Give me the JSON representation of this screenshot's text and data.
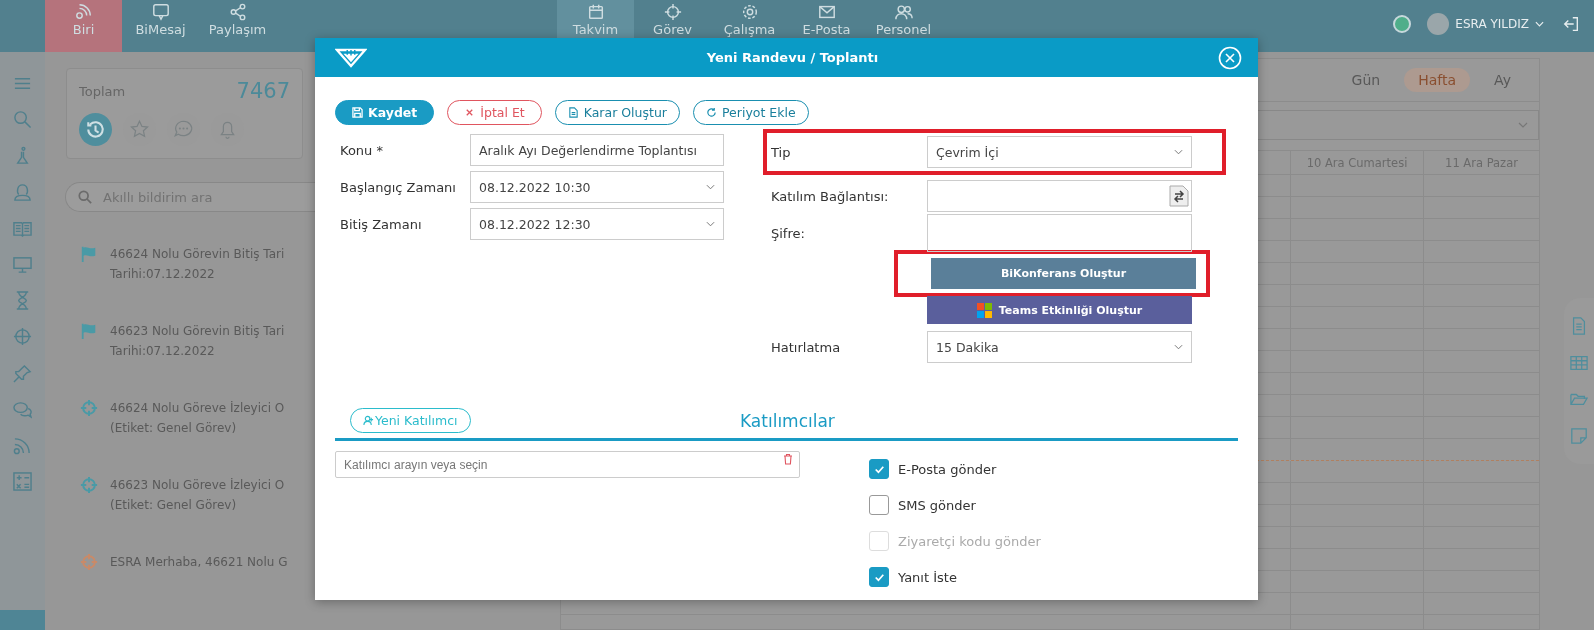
{
  "top_nav": {
    "left_items": [
      {
        "label": "Biri",
        "selected": true
      },
      {
        "label": "BiMesaj",
        "selected": false
      },
      {
        "label": "Paylaşım",
        "selected": false
      }
    ],
    "center_items": [
      {
        "label": "Takvim",
        "selected": true
      },
      {
        "label": "Görev",
        "selected": false
      },
      {
        "label": "Çalışma",
        "selected": false
      },
      {
        "label": "E-Posta",
        "selected": false
      },
      {
        "label": "Personel",
        "selected": false
      }
    ],
    "user": {
      "name": "ESRA YILDIZ"
    }
  },
  "summary": {
    "label": "Toplam",
    "count": "7467"
  },
  "notification_search": {
    "placeholder": "Akıllı bildirim ara"
  },
  "notifications": [
    {
      "kind": "flag",
      "color": "#4a9aa6",
      "lines": [
        "46624 Nolu Görevin Bitiş Tari",
        "Tarihi:07.12.2022"
      ]
    },
    {
      "kind": "flag",
      "color": "#4a9aa6",
      "lines": [
        "46623 Nolu Görevin Bitiş Tari",
        "Tarihi:07.12.2022"
      ]
    },
    {
      "kind": "target",
      "color": "#4a9aa6",
      "lines": [
        "46624 Nolu Göreve İzleyici O",
        "(Etiket: Genel Görev)"
      ]
    },
    {
      "kind": "target",
      "color": "#4a9aa6",
      "lines": [
        "46623 Nolu Göreve İzleyici O",
        "(Etiket: Genel Görev)"
      ]
    },
    {
      "kind": "target",
      "color": "#c98a68",
      "lines": [
        "ESRA Merhaba, 46621 Nolu G"
      ]
    }
  ],
  "calendar": {
    "views": [
      {
        "label": "Gün",
        "selected": false
      },
      {
        "label": "Hafta",
        "selected": true
      },
      {
        "label": "Ay",
        "selected": false
      }
    ],
    "columns": [
      "10 Ara Cumartesi",
      "11 Ara Pazar"
    ]
  },
  "dialog": {
    "title": "Yeni Randevu / Toplantı",
    "actions": [
      {
        "kind": "primary",
        "label": "Kaydet"
      },
      {
        "kind": "danger",
        "label": "İptal Et"
      },
      {
        "kind": "document",
        "label": "Karar Oluştur"
      },
      {
        "kind": "repeat",
        "label": "Periyot Ekle"
      }
    ],
    "left_fields": [
      {
        "kind": "text",
        "label": "Konu *",
        "value": "Aralık Ayı Değerlendirme Toplantısı"
      },
      {
        "kind": "select",
        "label": "Başlangıç Zamanı",
        "value": "08.12.2022 10:30"
      },
      {
        "kind": "select",
        "label": "Bitiş Zamanı",
        "value": "08.12.2022 12:30"
      }
    ],
    "right_fields": [
      {
        "kind": "select",
        "label": "Tip",
        "value": "Çevrim İçi",
        "highlighted": true
      },
      {
        "kind": "link",
        "label": "Katılım Bağlantısı:",
        "highlighted": false
      },
      {
        "kind": "password",
        "label": "Şifre:",
        "highlighted": false
      }
    ],
    "conference_buttons": [
      {
        "kind": "bikonferans",
        "label": "BiKonferans Oluştur",
        "highlighted": true
      },
      {
        "kind": "teams",
        "label": "Teams Etkinliği Oluştur",
        "highlighted": false
      }
    ],
    "reminder": {
      "label": "Hatırlatma",
      "value": "15 Dakika"
    },
    "participants": {
      "add_button": "Yeni Katılımcı",
      "title": "Katılımcılar",
      "search": {
        "placeholder": "Katılımcı arayın veya seçin"
      },
      "options": [
        {
          "label": "E-Posta gönder",
          "checked": true,
          "disabled": false
        },
        {
          "label": "SMS gönder",
          "checked": false,
          "disabled": false
        },
        {
          "label": "Ziyaretçi kodu gönder",
          "checked": false,
          "disabled": true
        },
        {
          "label": "Yanıt İste",
          "checked": true,
          "disabled": false
        }
      ]
    }
  }
}
